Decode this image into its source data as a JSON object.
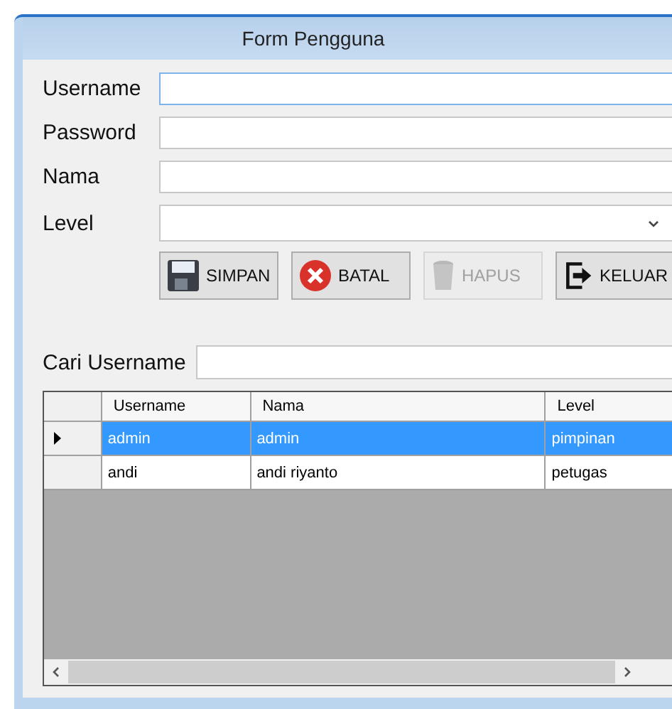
{
  "window": {
    "title": "Form Pengguna"
  },
  "fields": [
    {
      "kind": "text",
      "label": "Username",
      "focused": true
    },
    {
      "kind": "text",
      "label": "Password",
      "focused": false
    },
    {
      "kind": "text",
      "label": "Nama",
      "focused": false
    },
    {
      "kind": "select",
      "label": "Level",
      "focused": false
    }
  ],
  "buttons": [
    {
      "label": "SIMPAN",
      "disabled": false
    },
    {
      "label": "BATAL",
      "disabled": false
    },
    {
      "label": "HAPUS",
      "disabled": true
    },
    {
      "label": "KELUAR",
      "disabled": false
    }
  ],
  "search": {
    "label": "Cari Username"
  },
  "table": {
    "columns": [
      "Username",
      "Nama",
      "Level"
    ],
    "rows": [
      {
        "cells": [
          "admin",
          "admin",
          "pimpinan"
        ],
        "selected": true
      },
      {
        "cells": [
          "andi",
          "andi riyanto",
          "petugas"
        ],
        "selected": false
      }
    ]
  }
}
